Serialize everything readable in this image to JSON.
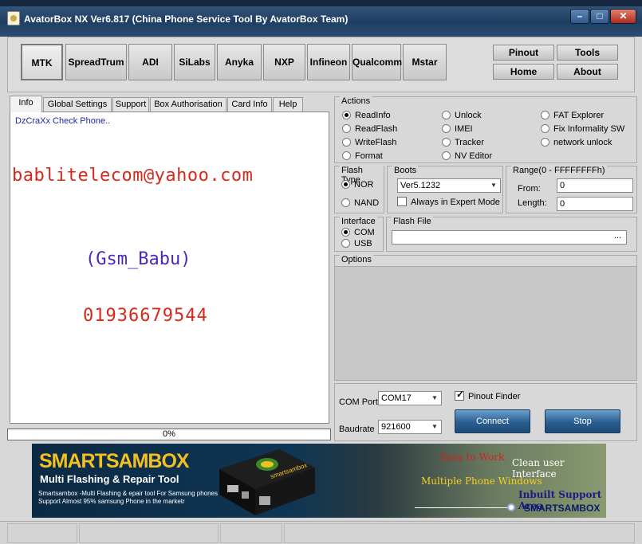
{
  "window": {
    "title": "AvatorBox NX Ver6.817 (China Phone Service Tool By AvatorBox Team)"
  },
  "cpu_tabs": [
    "MTK",
    "SpreadTrum",
    "ADI",
    "SiLabs",
    "Anyka",
    "NXP",
    "Infineon",
    "Qualcomm",
    "Mstar"
  ],
  "top_buttons": {
    "pinout": "Pinout",
    "tools": "Tools",
    "home": "Home",
    "about": "About"
  },
  "tabs": [
    "Info",
    "Global Settings",
    "Support",
    "Box Authorisation",
    "Card Info",
    "Help"
  ],
  "info": {
    "log": "DzCraXx Check Phone..",
    "watermark_email": "bablitelecom@yahoo.com",
    "watermark_name": "(Gsm_Babu)",
    "watermark_phone": "01936679544"
  },
  "progress": {
    "text": "0%",
    "value": 0
  },
  "actions": {
    "label": "Actions",
    "items": [
      "ReadInfo",
      "ReadFlash",
      "WriteFlash",
      "Format",
      "Unlock",
      "IMEI",
      "Tracker",
      "NV Editor",
      "FAT Explorer",
      "Fix Informality SW",
      "network unlock"
    ],
    "selected": "ReadInfo"
  },
  "flash_type": {
    "label": "Flash Type",
    "options": [
      "NOR",
      "NAND"
    ],
    "selected": "NOR"
  },
  "boots": {
    "label": "Boots",
    "value": "Ver5.1232",
    "expert_label": "Always in Expert Mode",
    "expert_checked": false
  },
  "range": {
    "label": "Range(0 - FFFFFFFFh)",
    "from_label": "From:",
    "from_value": "0",
    "length_label": "Length:",
    "length_value": "0"
  },
  "interface": {
    "label": "Interface",
    "options": [
      "COM",
      "USB"
    ],
    "selected": "COM"
  },
  "flash_file": {
    "label": "Flash File",
    "value": "",
    "browse": "..."
  },
  "options": {
    "label": "Options"
  },
  "com": {
    "port_label": "COM Port",
    "port_value": "COM17",
    "baud_label": "Baudrate",
    "baud_value": "921600",
    "pinout_finder_label": "Pinout Finder",
    "pinout_finder_checked": true,
    "connect": "Connect",
    "stop": "Stop"
  },
  "banner": {
    "title": "SMARTSAMBOX",
    "subtitle": "Multi Flashing & Repair Tool",
    "line1": "Smartsambox -Multi Flashing & epair tool For Samsung phones",
    "line2": "Support Almost 95% samsung  Phone in the marketr",
    "box_label": "smartsambox",
    "easy": "Easy to Work",
    "clean": "Clean user Interface",
    "multi": "Multiple Phone Windows",
    "inbuilt": "Inbuilt Support Area",
    "brand": "SMARTSAMBOX"
  },
  "colors": {
    "titlebar": "#1f3e62",
    "watermark_red": "#d8281c",
    "watermark_purple": "#4c28b8",
    "log_blue": "#1a28a8",
    "banner_gold": "#f4c020"
  }
}
